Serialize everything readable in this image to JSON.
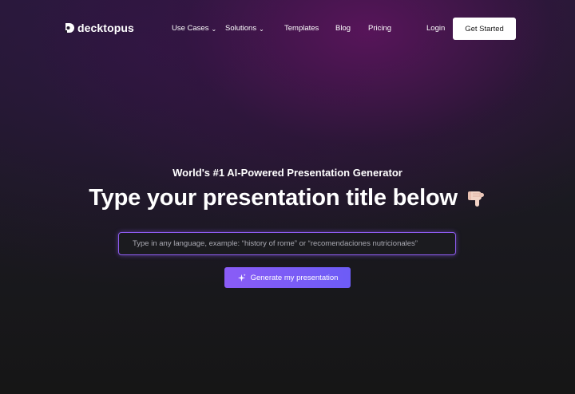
{
  "brand": {
    "name": "decktopus",
    "icon": "decktopus-logo-icon"
  },
  "nav": {
    "items": [
      {
        "label": "Use Cases",
        "dropdown": true
      },
      {
        "label": "Solutions",
        "dropdown": true
      },
      {
        "label": "Templates",
        "dropdown": false
      },
      {
        "label": "Blog",
        "dropdown": false
      },
      {
        "label": "Pricing",
        "dropdown": false
      }
    ],
    "login": "Login",
    "cta": "Get Started"
  },
  "hero": {
    "subtitle": "World's #1 AI-Powered Presentation Generator",
    "title": "Type your presentation title below",
    "title_icon": "pointing-down-hand-icon",
    "input": {
      "value": "",
      "placeholder": "Type in any language, example: “history of rome” or “recomendaciones nutricionales”"
    },
    "button": "Generate my presentation",
    "button_icon": "sparkle-icon"
  },
  "colors": {
    "accent": "#8e5cf0",
    "button_gradient_start": "#8a5cf6",
    "button_gradient_end": "#6d5cf6",
    "cta_bg": "#ffffff"
  }
}
